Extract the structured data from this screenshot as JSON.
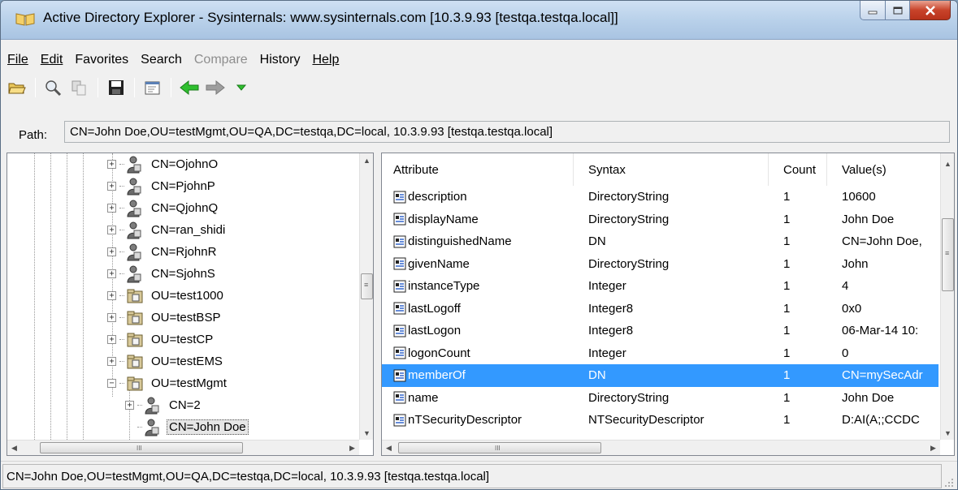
{
  "window": {
    "title": "Active Directory Explorer - Sysinternals: www.sysinternals.com [10.3.9.93 [testqa.testqa.local]]"
  },
  "menu": [
    {
      "label": "File",
      "enabled": true
    },
    {
      "label": "Edit",
      "enabled": true
    },
    {
      "label": "Favorites",
      "enabled": true
    },
    {
      "label": "Search",
      "enabled": true
    },
    {
      "label": "Compare",
      "enabled": false
    },
    {
      "label": "History",
      "enabled": true
    },
    {
      "label": "Help",
      "enabled": true
    }
  ],
  "toolbar": {
    "icons": [
      "open-folder-icon",
      "connect-icon",
      "disconnect-icon",
      "save-icon",
      "properties-icon",
      "back-arrow-icon",
      "forward-arrow-icon",
      "history-dropdown-icon"
    ]
  },
  "path": {
    "label": "Path:",
    "value": "CN=John Doe,OU=testMgmt,OU=QA,DC=testqa,DC=local, 10.3.9.93 [testqa.testqa.local]"
  },
  "tree": {
    "items": [
      {
        "label": "CN=OjohnO",
        "type": "user",
        "expander": "+"
      },
      {
        "label": "CN=PjohnP",
        "type": "user",
        "expander": "+"
      },
      {
        "label": "CN=QjohnQ",
        "type": "user",
        "expander": "+"
      },
      {
        "label": "CN=ran_shidi",
        "type": "user",
        "expander": "+"
      },
      {
        "label": "CN=RjohnR",
        "type": "user",
        "expander": "+"
      },
      {
        "label": "CN=SjohnS",
        "type": "user",
        "expander": "+"
      },
      {
        "label": "OU=test1000",
        "type": "ou",
        "expander": "+"
      },
      {
        "label": "OU=testBSP",
        "type": "ou",
        "expander": "+"
      },
      {
        "label": "OU=testCP",
        "type": "ou",
        "expander": "+"
      },
      {
        "label": "OU=testEMS",
        "type": "ou",
        "expander": "+"
      },
      {
        "label": "OU=testMgmt",
        "type": "ou",
        "expander": "−"
      },
      {
        "label": "CN=2",
        "type": "user",
        "expander": "+"
      },
      {
        "label": "CN=John Doe",
        "type": "user",
        "expander": ""
      }
    ]
  },
  "list": {
    "columns": [
      "Attribute",
      "Syntax",
      "Count",
      "Value(s)"
    ],
    "rows": [
      {
        "attribute": "description",
        "syntax": "DirectoryString",
        "count": "1",
        "value": "10600"
      },
      {
        "attribute": "displayName",
        "syntax": "DirectoryString",
        "count": "1",
        "value": "John Doe"
      },
      {
        "attribute": "distinguishedName",
        "syntax": "DN",
        "count": "1",
        "value": "CN=John Doe,"
      },
      {
        "attribute": "givenName",
        "syntax": "DirectoryString",
        "count": "1",
        "value": "John"
      },
      {
        "attribute": "instanceType",
        "syntax": "Integer",
        "count": "1",
        "value": "4"
      },
      {
        "attribute": "lastLogoff",
        "syntax": "Integer8",
        "count": "1",
        "value": "0x0"
      },
      {
        "attribute": "lastLogon",
        "syntax": "Integer8",
        "count": "1",
        "value": "06-Mar-14 10:"
      },
      {
        "attribute": "logonCount",
        "syntax": "Integer",
        "count": "1",
        "value": "0"
      },
      {
        "attribute": "memberOf",
        "syntax": "DN",
        "count": "1",
        "value": "CN=mySecAdr",
        "selected": true
      },
      {
        "attribute": "name",
        "syntax": "DirectoryString",
        "count": "1",
        "value": "John Doe"
      },
      {
        "attribute": "nTSecurityDescriptor",
        "syntax": "NTSecurityDescriptor",
        "count": "1",
        "value": "D:AI(A;;CCDC"
      }
    ]
  },
  "status": {
    "text": "CN=John Doe,OU=testMgmt,OU=QA,DC=testqa,DC=local, 10.3.9.93 [testqa.testqa.local]"
  },
  "colors": {
    "selection": "#3399ff",
    "arrow_green": "#2fbf2f"
  }
}
